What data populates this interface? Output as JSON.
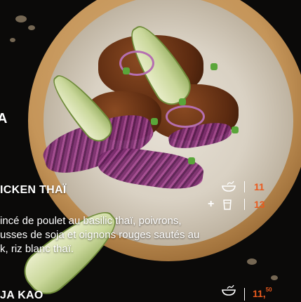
{
  "menu": {
    "section_letter": "A",
    "item1": {
      "title": "ICKEN THAÏ",
      "desc_line1": "incé de poulet au basilic thaï, poivrons,",
      "desc_line2": "usses de soja et oignons rouges sautés au",
      "desc_line3": "k, riz blanc thaï.",
      "price_bowl": "11",
      "plus": "+",
      "price_combo": "13"
    },
    "item2": {
      "title": "JA KAO",
      "price_main": "11,",
      "price_cents": "50"
    }
  },
  "icons": {
    "bowl": "bowl-icon",
    "drink": "cup-icon"
  },
  "colors": {
    "price": "#e95a1e",
    "text": "#ffffff",
    "background": "#0b0a09"
  }
}
